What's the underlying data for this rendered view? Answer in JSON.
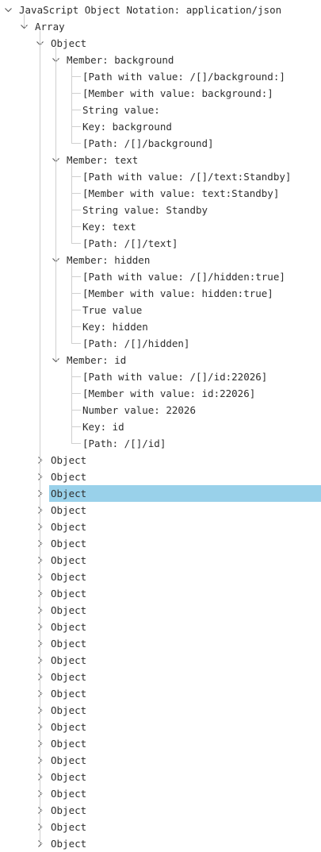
{
  "tree": {
    "root": "JavaScript Object Notation: application/json",
    "array": "Array",
    "object0": {
      "label": "Object",
      "members": [
        {
          "label": "Member: background",
          "children": [
            "[Path with value: /[]/background:]",
            "[Member with value: background:]",
            "String value:",
            "Key: background",
            "[Path: /[]/background]"
          ]
        },
        {
          "label": "Member: text",
          "children": [
            "[Path with value: /[]/text:Standby]",
            "[Member with value: text:Standby]",
            "String value: Standby",
            "Key: text",
            "[Path: /[]/text]"
          ]
        },
        {
          "label": "Member: hidden",
          "children": [
            "[Path with value: /[]/hidden:true]",
            "[Member with value: hidden:true]",
            "True value",
            "Key: hidden",
            "[Path: /[]/hidden]"
          ]
        },
        {
          "label": "Member: id",
          "children": [
            "[Path with value: /[]/id:22026]",
            "[Member with value: id:22026]",
            "Number value: 22026",
            "Key: id",
            "[Path: /[]/id]"
          ]
        }
      ]
    },
    "collapsed_objects": [
      "Object",
      "Object",
      "Object",
      "Object",
      "Object",
      "Object",
      "Object",
      "Object",
      "Object",
      "Object",
      "Object",
      "Object",
      "Object",
      "Object",
      "Object",
      "Object",
      "Object",
      "Object",
      "Object",
      "Object",
      "Object",
      "Object",
      "Object",
      "Object"
    ],
    "selected_collapsed_index": 2
  },
  "colors": {
    "selection": "#99d1ea",
    "guide": "#cfcfcf",
    "text": "#2e2e2e"
  }
}
